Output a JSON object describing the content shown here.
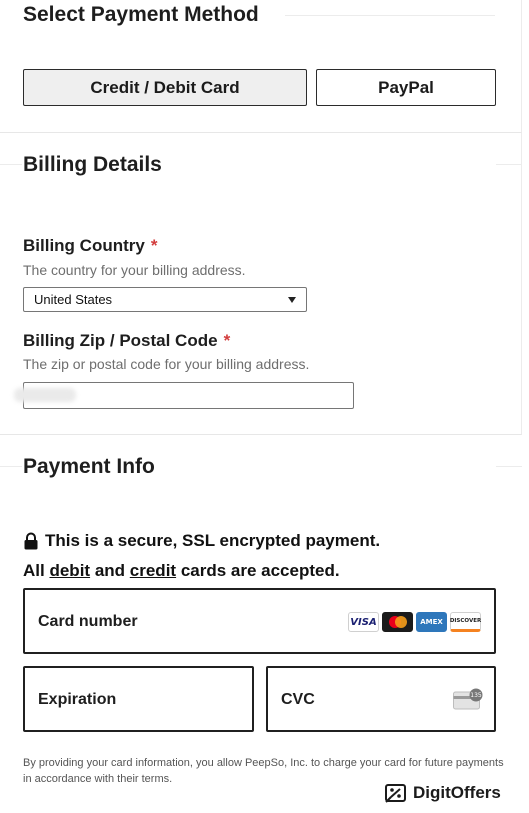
{
  "payment_method": {
    "title": "Select Payment Method",
    "options": [
      "Credit / Debit Card",
      "PayPal"
    ],
    "selected": "Credit / Debit Card"
  },
  "billing": {
    "title": "Billing Details",
    "country": {
      "label": "Billing Country",
      "required_mark": "*",
      "help": "The country for your billing address.",
      "value": "United States"
    },
    "zip": {
      "label": "Billing Zip / Postal Code",
      "required_mark": "*",
      "help": "The zip or postal code for your billing address."
    }
  },
  "payment_info": {
    "title": "Payment Info",
    "secure_text": "This is a secure, SSL encrypted payment.",
    "accepted": {
      "prefix": "All",
      "debit": "debit",
      "and": "and",
      "credit": "credit",
      "suffix": "cards are accepted."
    },
    "card_number_label": "Card number",
    "expiration_label": "Expiration",
    "cvc_label": "CVC",
    "cvc_icon_text": "135",
    "card_brands": [
      "VISA",
      "AMEX",
      "DISCOVER"
    ],
    "brand_colors": {
      "visa": "#1a1f71",
      "mastercard_red": "#eb001b",
      "mastercard_yellow": "#f79e1b",
      "amex": "#2e77bb",
      "discover": "#f58220"
    }
  },
  "terms": "By providing your card information, you allow PeepSo, Inc. to charge your card for future payments in accordance with their terms.",
  "watermark": {
    "icon": "percent-icon",
    "text": "DigitOffers"
  }
}
